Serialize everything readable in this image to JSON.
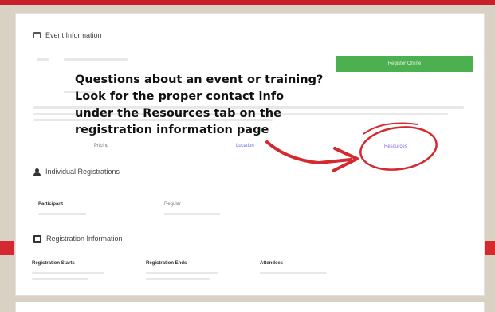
{
  "callout": {
    "line1": "Questions about an event or training?",
    "line2": "Look for the proper contact info",
    "line3": "under the Resources tab on the",
    "line4": "registration information page"
  },
  "event_info": {
    "heading": "Event Information",
    "register_button": "Register Online",
    "tabs": {
      "pricing": "Pricing",
      "location": "Location",
      "resources": "Resources"
    }
  },
  "individual_registrations": {
    "heading": "Individual Registrations",
    "participant_label": "Participant",
    "regular_label": "Regular"
  },
  "registration_information": {
    "heading": "Registration Information",
    "starts_label": "Registration Starts",
    "ends_label": "Registration Ends",
    "attendees_label": "Attendees"
  },
  "colors": {
    "accent_red": "#d42a2f",
    "button_green": "#4caf50",
    "link_purple": "#7b68ee"
  }
}
